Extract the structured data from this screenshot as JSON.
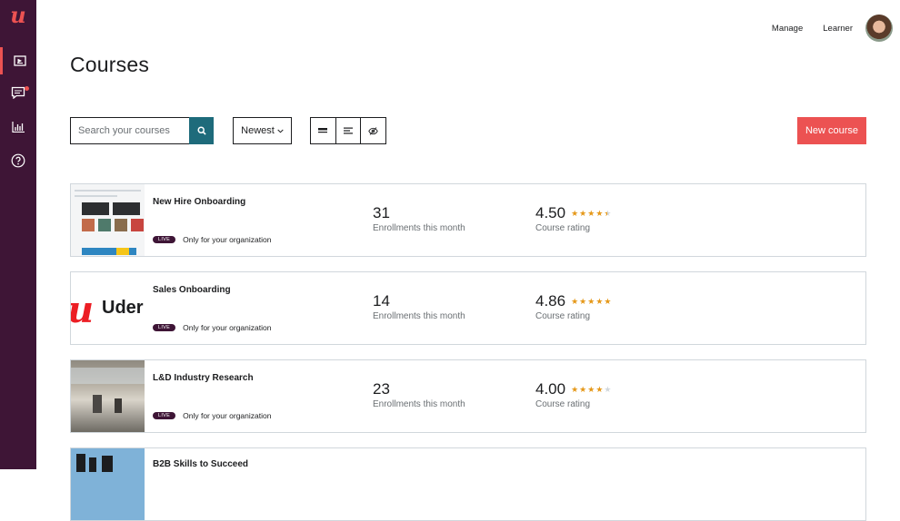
{
  "sidebar": {
    "logo": "u",
    "items": [
      {
        "icon": "course-display-icon",
        "active": true
      },
      {
        "icon": "messages-icon",
        "active": false,
        "notification": true
      },
      {
        "icon": "bar-chart-icon",
        "active": false
      },
      {
        "icon": "help-icon",
        "active": false
      }
    ]
  },
  "header": {
    "manage_label": "Manage",
    "learner_label": "Learner"
  },
  "page": {
    "title": "Courses"
  },
  "toolbar": {
    "search_placeholder": "Search your courses",
    "sort_label": "Newest",
    "new_course_label": "New course"
  },
  "courses": [
    {
      "name": "New Hire Onboarding",
      "badge": "LIVE",
      "visibility": "Only for your organization",
      "enrollments": "31",
      "enrollments_label": "Enrollments this month",
      "rating": "4.50",
      "rating_value": 4.5,
      "rating_label": "Course rating"
    },
    {
      "name": "Sales Onboarding",
      "thumb_text": "Uder",
      "badge": "LIVE",
      "visibility": "Only for your organization",
      "enrollments": "14",
      "enrollments_label": "Enrollments this month",
      "rating": "4.86",
      "rating_value": 4.86,
      "rating_label": "Course rating"
    },
    {
      "name": "L&D Industry Research",
      "badge": "LIVE",
      "visibility": "Only for your organization",
      "enrollments": "23",
      "enrollments_label": "Enrollments this month",
      "rating": "4.00",
      "rating_value": 4.0,
      "rating_label": "Course rating"
    },
    {
      "name": "B2B Skills to Succeed"
    }
  ],
  "colors": {
    "sidebar": "#3e1536",
    "accent": "#ec5252",
    "search_button": "#1e6b7b",
    "star": "#e59819"
  }
}
